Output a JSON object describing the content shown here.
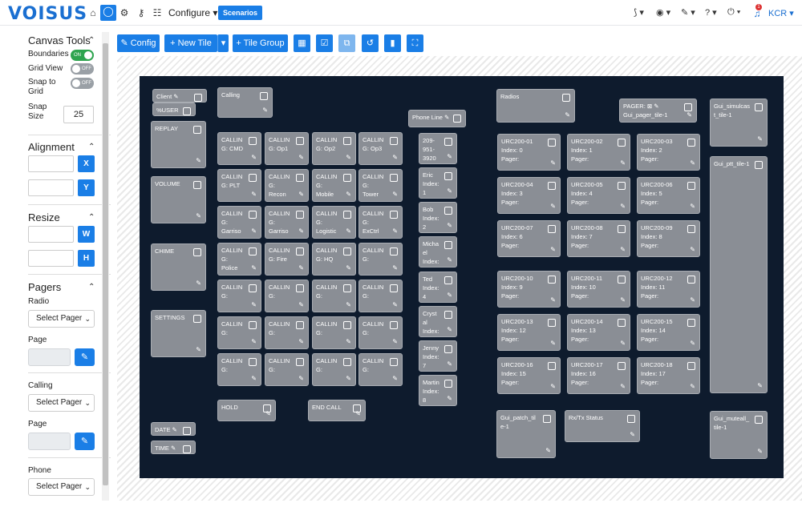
{
  "topbar": {
    "logo": "VOISUS",
    "icons": [
      "home-icon",
      "chat-icon",
      "gear-icon",
      "key-icon",
      "team-icon"
    ],
    "configure": "Configure ▾",
    "scenarios": "Scenarios",
    "right_tools": [
      "⟆ ▾",
      "◉ ▾",
      "✎ ▾",
      "? ▾",
      "⏻ ▾"
    ],
    "notif_count": "1",
    "user": "KCR ▾"
  },
  "sidebar": {
    "canvas_tools": "Canvas Tools",
    "boundaries": "Boundaries",
    "boundaries_state": "ON",
    "grid_view": "Grid View",
    "grid_view_state": "OFF",
    "snap_to_grid": "Snap to\nGrid",
    "snap_to_grid_state": "OFF",
    "snap_size_label": "Snap\nSize",
    "snap_size": "25",
    "alignment": "Alignment",
    "x": "X",
    "y": "Y",
    "resize": "Resize",
    "w": "W",
    "h": "H",
    "pagers": "Pagers",
    "radio": "Radio",
    "select_pager": "Select Pager",
    "page": "Page",
    "calling": "Calling",
    "phone": "Phone"
  },
  "toolbar": {
    "config": "✎ Config",
    "new_tile": "+ New Tile",
    "tile_group": "+ Tile Group"
  },
  "tiles": [
    {
      "id": "client",
      "label": "Client ✎"
    },
    {
      "id": "user",
      "label": "%USER"
    },
    {
      "id": "replay",
      "label": "REPLAY"
    },
    {
      "id": "volume",
      "label": "VOLUME"
    },
    {
      "id": "chime",
      "label": "CHIME"
    },
    {
      "id": "settings",
      "label": "SETTINGS"
    },
    {
      "id": "date",
      "label": "DATE ✎"
    },
    {
      "id": "time",
      "label": "TIME ✎"
    },
    {
      "id": "calling",
      "label": "Calling"
    },
    {
      "id": "c1",
      "label": "CALLIN\nG: CMD"
    },
    {
      "id": "c2",
      "label": "CALLIN\nG: Op1"
    },
    {
      "id": "c3",
      "label": "CALLIN\nG: Op2"
    },
    {
      "id": "c4",
      "label": "CALLIN\nG: Op3"
    },
    {
      "id": "c5",
      "label": "CALLIN\nG: PLT"
    },
    {
      "id": "c6",
      "label": "CALLIN\nG:\nRecon"
    },
    {
      "id": "c7",
      "label": "CALLIN\nG:\nMobile"
    },
    {
      "id": "c8",
      "label": "CALLIN\nG:\nTower"
    },
    {
      "id": "c9",
      "label": "CALLIN\nG:\nGarriso"
    },
    {
      "id": "c10",
      "label": "CALLIN\nG:\nGarriso"
    },
    {
      "id": "c11",
      "label": "CALLIN\nG:\nLogistic"
    },
    {
      "id": "c12",
      "label": "CALLIN\nG:\nExCtrl"
    },
    {
      "id": "c13",
      "label": "CALLIN\nG:\nPolice"
    },
    {
      "id": "c14",
      "label": "CALLIN\nG: Fire"
    },
    {
      "id": "c15",
      "label": "CALLIN\nG: HQ"
    },
    {
      "id": "c16",
      "label": "CALLIN\nG:"
    },
    {
      "id": "c17",
      "label": "CALLIN\nG:"
    },
    {
      "id": "c18",
      "label": "CALLIN\nG:"
    },
    {
      "id": "c19",
      "label": "CALLIN\nG:"
    },
    {
      "id": "c20",
      "label": "CALLIN\nG:"
    },
    {
      "id": "c21",
      "label": "CALLIN\nG:"
    },
    {
      "id": "c22",
      "label": "CALLIN\nG:"
    },
    {
      "id": "c23",
      "label": "CALLIN\nG:"
    },
    {
      "id": "c24",
      "label": "CALLIN\nG:"
    },
    {
      "id": "c25",
      "label": "CALLIN\nG:"
    },
    {
      "id": "c26",
      "label": "CALLIN\nG:"
    },
    {
      "id": "c27",
      "label": "CALLIN\nG:"
    },
    {
      "id": "c28",
      "label": "CALLIN\nG:"
    },
    {
      "id": "hold",
      "label": "HOLD"
    },
    {
      "id": "endcall",
      "label": "END CALL"
    },
    {
      "id": "phoneline",
      "label": "Phone Line ✎"
    },
    {
      "id": "p1",
      "label": "209-\n951-\n3920"
    },
    {
      "id": "p2",
      "label": "Eric\nIndex:\n1"
    },
    {
      "id": "p3",
      "label": "Bob\nIndex:\n2"
    },
    {
      "id": "p4",
      "label": "Micha\nel\nIndex:"
    },
    {
      "id": "p5",
      "label": "Ted\nIndex:\n4"
    },
    {
      "id": "p6",
      "label": "Cryst\nal\nIndex:"
    },
    {
      "id": "p7",
      "label": "Jenny\nIndex:\n7"
    },
    {
      "id": "p8",
      "label": "Martin\nIndex:\n8"
    },
    {
      "id": "radios",
      "label": "Radios"
    },
    {
      "id": "pager",
      "label": "PAGER: ⊠ ✎\nGui_pager_tile-1"
    },
    {
      "id": "r1",
      "label": "URC200-01\nIndex: 0\nPager:"
    },
    {
      "id": "r2",
      "label": "URC200-02\nIndex: 1\nPager:"
    },
    {
      "id": "r3",
      "label": "URC200-03\nIndex: 2\nPager:"
    },
    {
      "id": "r4",
      "label": "URC200-04\nIndex: 3\nPager:"
    },
    {
      "id": "r5",
      "label": "URC200-05\nIndex: 4\nPager:"
    },
    {
      "id": "r6",
      "label": "URC200-06\nIndex: 5\nPager:"
    },
    {
      "id": "r7",
      "label": "URC200-07\nIndex: 6\nPager:"
    },
    {
      "id": "r8",
      "label": "URC200-08\nIndex: 7\nPager:"
    },
    {
      "id": "r9",
      "label": "URC200-09\nIndex: 8\nPager:"
    },
    {
      "id": "r10",
      "label": "URC200-10\nIndex: 9\nPager:"
    },
    {
      "id": "r11",
      "label": "URC200-11\nIndex: 10\nPager:"
    },
    {
      "id": "r12",
      "label": "URC200-12\nIndex: 11\nPager:"
    },
    {
      "id": "r13",
      "label": "URC200-13\nIndex: 12\nPager:"
    },
    {
      "id": "r14",
      "label": "URC200-14\nIndex: 13\nPager:"
    },
    {
      "id": "r15",
      "label": "URC200-15\nIndex: 14\nPager:"
    },
    {
      "id": "r16",
      "label": "URC200-16\nIndex: 15\nPager:"
    },
    {
      "id": "r17",
      "label": "URC200-17\nIndex: 16\nPager:"
    },
    {
      "id": "r18",
      "label": "URC200-18\nIndex: 17\nPager:"
    },
    {
      "id": "patch",
      "label": "Gui_patch_til\ne-1"
    },
    {
      "id": "rxtx",
      "label": "Rx/Tx Status"
    },
    {
      "id": "simul",
      "label": "Gui_simulcas\nt_tile-1"
    },
    {
      "id": "plt",
      "label": "Gui_ptt_tile-1"
    },
    {
      "id": "muteall",
      "label": "Gui_muteall_\ntile-1"
    }
  ]
}
